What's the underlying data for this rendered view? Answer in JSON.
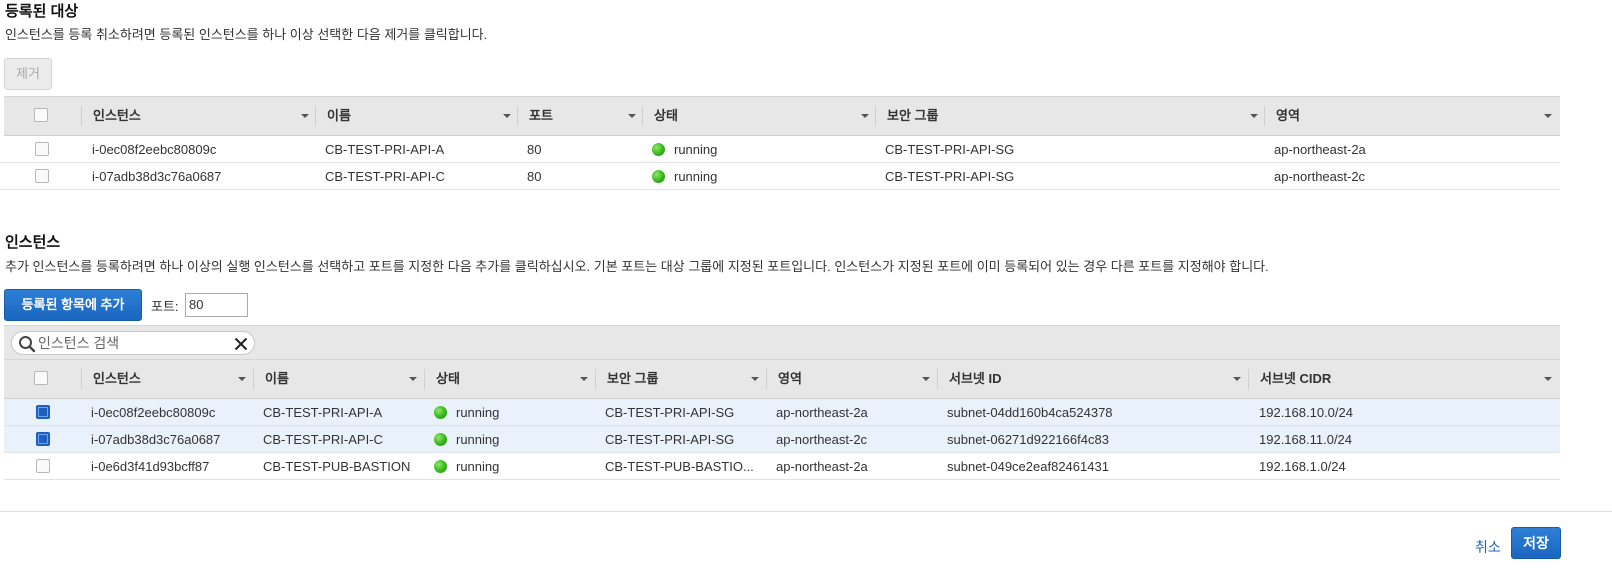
{
  "registered": {
    "title": "등록된 대상",
    "description": "인스턴스를 등록 취소하려면 등록된 인스턴스를 하나 이상 선택한 다음 제거를 클릭합니다.",
    "remove_label": "제거",
    "columns": [
      "인스턴스",
      "이름",
      "포트",
      "상태",
      "보안 그룹",
      "영역"
    ],
    "rows": [
      {
        "instance": "i-0ec08f2eebc80809c",
        "name": "CB-TEST-PRI-API-A",
        "port": "80",
        "status": "running",
        "sg": "CB-TEST-PRI-API-SG",
        "zone": "ap-northeast-2a",
        "checked": false
      },
      {
        "instance": "i-07adb38d3c76a0687",
        "name": "CB-TEST-PRI-API-C",
        "port": "80",
        "status": "running",
        "sg": "CB-TEST-PRI-API-SG",
        "zone": "ap-northeast-2c",
        "checked": false
      }
    ]
  },
  "instances": {
    "title": "인스턴스",
    "description": "추가 인스턴스를 등록하려면 하나 이상의 실행 인스턴스를 선택하고 포트를 지정한 다음 추가를 클릭하십시오. 기본 포트는 대상 그룹에 지정된 포트입니다. 인스턴스가 지정된 포트에 이미 등록되어 있는 경우 다른 포트를 지정해야 합니다.",
    "add_label": "등록된 항목에 추가",
    "port_label": "포트:",
    "port_value": "80",
    "search_placeholder": "인스턴스 검색",
    "columns": [
      "인스턴스",
      "이름",
      "상태",
      "보안 그룹",
      "영역",
      "서브넷 ID",
      "서브넷 CIDR"
    ],
    "rows": [
      {
        "instance": "i-0ec08f2eebc80809c",
        "name": "CB-TEST-PRI-API-A",
        "status": "running",
        "sg": "CB-TEST-PRI-API-SG",
        "zone": "ap-northeast-2a",
        "subnet": "subnet-04dd160b4ca524378",
        "cidr": "192.168.10.0/24",
        "checked": true
      },
      {
        "instance": "i-07adb38d3c76a0687",
        "name": "CB-TEST-PRI-API-C",
        "status": "running",
        "sg": "CB-TEST-PRI-API-SG",
        "zone": "ap-northeast-2c",
        "subnet": "subnet-06271d922166f4c83",
        "cidr": "192.168.11.0/24",
        "checked": true
      },
      {
        "instance": "i-0e6d3f41d93bcff87",
        "name": "CB-TEST-PUB-BASTION",
        "status": "running",
        "sg": "CB-TEST-PUB-BASTIO...",
        "zone": "ap-northeast-2a",
        "subnet": "subnet-049ce2eaf82461431",
        "cidr": "192.168.1.0/24",
        "checked": false
      }
    ]
  },
  "footer": {
    "cancel_label": "취소",
    "save_label": "저장"
  },
  "colors": {
    "primary": "#1a66c0",
    "running": "#34b61a",
    "selected_row": "#e9f1fb",
    "header_bg": "#e7e7e7"
  },
  "icons": [
    "search-icon",
    "clear-icon",
    "sort-caret-icon",
    "status-running-icon"
  ]
}
